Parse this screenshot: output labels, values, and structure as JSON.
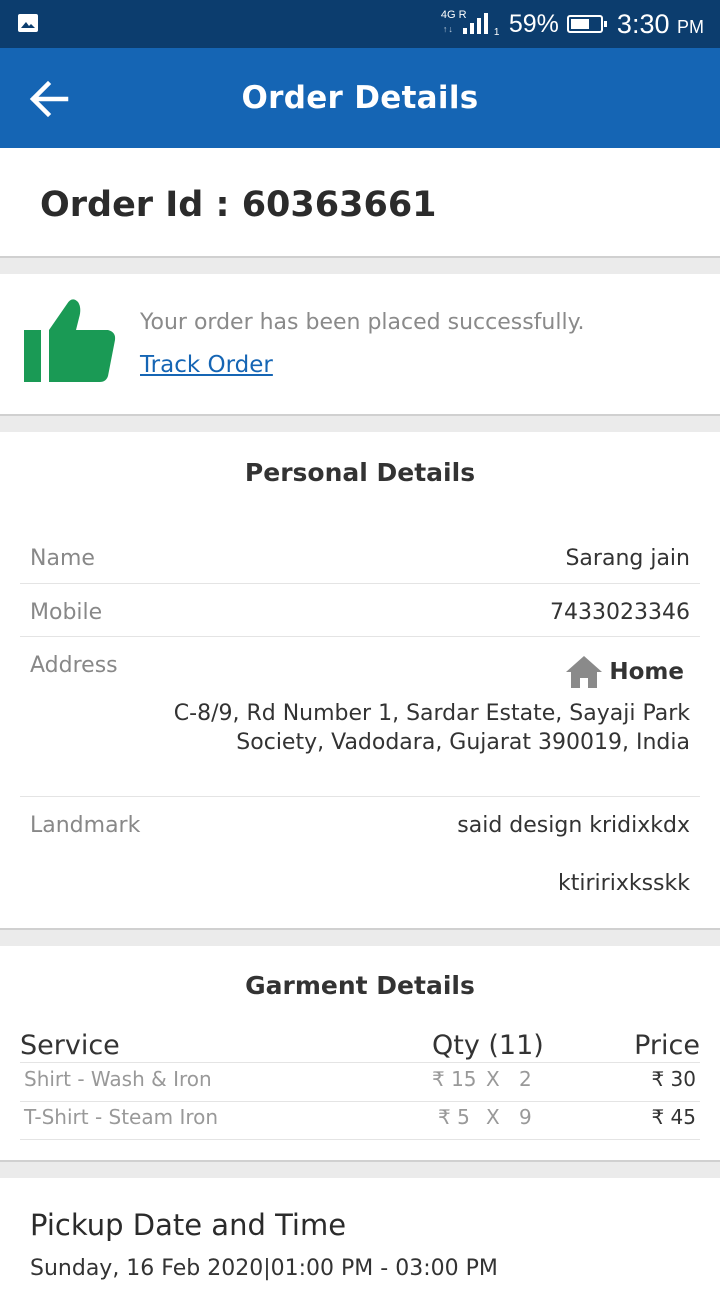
{
  "status_bar": {
    "network": "4G R",
    "sim_slot": "1",
    "battery": "59%",
    "time": "3:30",
    "ampm": "PM"
  },
  "app_bar": {
    "title": "Order Details"
  },
  "order": {
    "id_label": "Order Id : 60363661"
  },
  "status": {
    "message": "Your order has been placed successfully.",
    "track_link": "Track Order"
  },
  "personal": {
    "title": "Personal Details",
    "name_label": "Name",
    "name": "Sarang jain",
    "mobile_label": "Mobile",
    "mobile": "7433023346",
    "address_label": "Address",
    "address_type": "Home",
    "address": "C-8/9, Rd Number 1, Sardar Estate, Sayaji Park Society, Vadodara, Gujarat 390019, India",
    "landmark_label": "Landmark",
    "landmark": "said design kridixkdx ktiririxksskk"
  },
  "garment": {
    "title": "Garment Details",
    "headers": {
      "service": "Service",
      "qty": "Qty (11)",
      "price": "Price"
    },
    "rows": [
      {
        "service": "Shirt - Wash & Iron",
        "unit": "₹ 15",
        "x": "X",
        "qty": "2",
        "price": "₹ 30"
      },
      {
        "service": "T-Shirt - Steam Iron",
        "unit": "₹ 5",
        "x": "X",
        "qty": "9",
        "price": "₹ 45"
      }
    ]
  },
  "pickup": {
    "title": "Pickup Date and Time",
    "value": "Sunday, 16 Feb 2020|01:00 PM - 03:00 PM"
  },
  "colors": {
    "status_bar": "#0c3d6e",
    "app_bar": "#1565b4",
    "thumb_icon": "#1a9a55",
    "link": "#1565b4"
  },
  "icons": {
    "gallery": "gallery-icon",
    "back": "back-arrow-icon",
    "thumb": "thumbs-up-icon",
    "home": "home-icon"
  }
}
